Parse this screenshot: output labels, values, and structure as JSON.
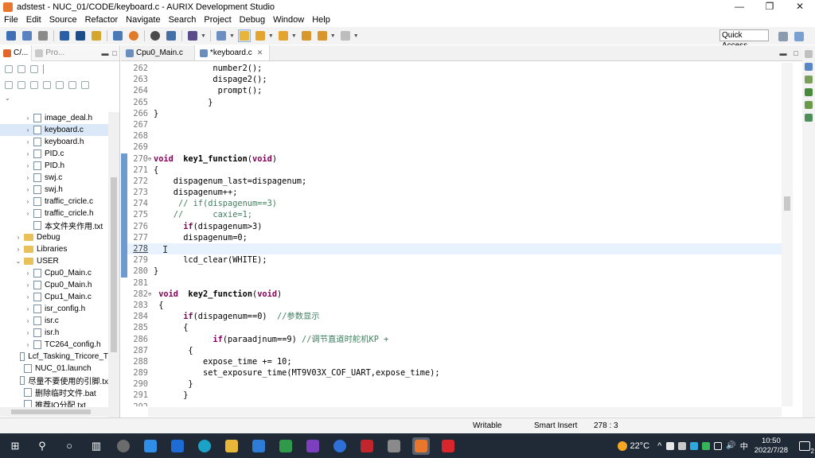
{
  "window": {
    "title": "adstest - NUC_01/CODE/keyboard.c - AURIX Development Studio",
    "controls": {
      "minimize": "—",
      "maximize": "❐",
      "close": "✕"
    }
  },
  "menu": [
    "File",
    "Edit",
    "Source",
    "Refactor",
    "Navigate",
    "Search",
    "Project",
    "Debug",
    "Window",
    "Help"
  ],
  "toolbar": {
    "quick_access": "Quick Access"
  },
  "left_panel": {
    "tabs": [
      {
        "label": "C/..."
      },
      {
        "label": "Pro..."
      }
    ],
    "tree": [
      {
        "label": "image_deal.h",
        "kind": "file",
        "expander": "›"
      },
      {
        "label": "keyboard.c",
        "kind": "file",
        "expander": "›",
        "selected": true
      },
      {
        "label": "keyboard.h",
        "kind": "file",
        "expander": "›"
      },
      {
        "label": "PID.c",
        "kind": "file",
        "expander": "›"
      },
      {
        "label": "PID.h",
        "kind": "file",
        "expander": "›"
      },
      {
        "label": "swj.c",
        "kind": "file",
        "expander": "›"
      },
      {
        "label": "swj.h",
        "kind": "file",
        "expander": "›"
      },
      {
        "label": "traffic_cricle.c",
        "kind": "file",
        "expander": "›"
      },
      {
        "label": "traffic_cricle.h",
        "kind": "file",
        "expander": "›"
      },
      {
        "label": "本文件夹作用.txt",
        "kind": "file",
        "expander": ""
      },
      {
        "label": "Debug",
        "kind": "folder",
        "expander": "›",
        "depth": 1
      },
      {
        "label": "Libraries",
        "kind": "folder",
        "expander": "›",
        "depth": 1
      },
      {
        "label": "USER",
        "kind": "folder",
        "expander": "⌄",
        "depth": 1
      },
      {
        "label": "Cpu0_Main.c",
        "kind": "file",
        "expander": "›"
      },
      {
        "label": "Cpu0_Main.h",
        "kind": "file",
        "expander": "›"
      },
      {
        "label": "Cpu1_Main.c",
        "kind": "file",
        "expander": "›"
      },
      {
        "label": "isr_config.h",
        "kind": "file",
        "expander": "›"
      },
      {
        "label": "isr.c",
        "kind": "file",
        "expander": "›"
      },
      {
        "label": "isr.h",
        "kind": "file",
        "expander": "›"
      },
      {
        "label": "TC264_config.h",
        "kind": "file",
        "expander": "›"
      },
      {
        "label": "Lcf_Tasking_Tricore_T",
        "kind": "file",
        "expander": "",
        "depth": 1
      },
      {
        "label": "NUC_01.launch",
        "kind": "file",
        "expander": "",
        "depth": 1
      },
      {
        "label": "尽量不要使用的引脚.tx",
        "kind": "file",
        "expander": "",
        "depth": 1
      },
      {
        "label": "删除临时文件.bat",
        "kind": "file",
        "expander": "",
        "depth": 1
      },
      {
        "label": "推荐IO分配.txt",
        "kind": "file",
        "expander": "",
        "depth": 1
      }
    ]
  },
  "editor": {
    "tabs": [
      {
        "label": "Cpu0_Main.c",
        "active": false,
        "close": ""
      },
      {
        "label": "*keyboard.c",
        "active": true,
        "close": "✕"
      }
    ],
    "lines": [
      {
        "n": "262",
        "text": "            number2();"
      },
      {
        "n": "263",
        "text": "            dispage2();"
      },
      {
        "n": "264",
        "text": "             prompt();"
      },
      {
        "n": "265",
        "text": "           }"
      },
      {
        "n": "266",
        "text": "}"
      },
      {
        "n": "267",
        "text": ""
      },
      {
        "n": "268",
        "text": ""
      },
      {
        "n": "269",
        "text": ""
      },
      {
        "n": "270",
        "text": "void  key1_function(void)",
        "fold": "⊖",
        "mark": true,
        "style": "decl"
      },
      {
        "n": "271",
        "text": "{",
        "mark": true
      },
      {
        "n": "272",
        "text": "    dispagenum_last=dispagenum;",
        "mark": true
      },
      {
        "n": "273",
        "text": "    dispagenum++;",
        "mark": true
      },
      {
        "n": "274",
        "text": "     // if(dispagenum==3)",
        "mark": true,
        "style": "comment"
      },
      {
        "n": "275",
        "text": "    //      caxie=1;",
        "mark": true,
        "style": "comment"
      },
      {
        "n": "276",
        "text": "      if(dispagenum>3)",
        "mark": true,
        "style": "if"
      },
      {
        "n": "277",
        "text": "      dispagenum=0;",
        "mark": true
      },
      {
        "n": "278",
        "text": "",
        "mark": true,
        "current": true
      },
      {
        "n": "279",
        "text": "      lcd_clear(WHITE);",
        "mark": true
      },
      {
        "n": "280",
        "text": "}",
        "mark": true
      },
      {
        "n": "281",
        "text": ""
      },
      {
        "n": "282",
        "text": " void  key2_function(void)",
        "fold": "⊖",
        "style": "decl"
      },
      {
        "n": "283",
        "text": " {"
      },
      {
        "n": "284",
        "text": "      if(dispagenum==0)  //参数显示",
        "style": "if-comment"
      },
      {
        "n": "285",
        "text": "      {"
      },
      {
        "n": "286",
        "text": "            if(paraadjnum==9) //调节直道时舵机KP +",
        "style": "if-comment"
      },
      {
        "n": "287",
        "text": "       {"
      },
      {
        "n": "288",
        "text": "          expose_time += 10;"
      },
      {
        "n": "289",
        "text": "          set_exposure_time(MT9V03X_COF_UART,expose_time);"
      },
      {
        "n": "290",
        "text": "       }"
      },
      {
        "n": "291",
        "text": "      }"
      },
      {
        "n": "292",
        "text": ""
      }
    ]
  },
  "status": {
    "writable": "Writable",
    "insert_mode": "Smart Insert",
    "position": "278 : 3"
  },
  "taskbar": {
    "weather": "22°C",
    "tray_arrow": "^",
    "clock_time": "10:50",
    "clock_date": "2022/7/28",
    "notification_count": "2",
    "volume": "🔊",
    "ime": "中"
  }
}
